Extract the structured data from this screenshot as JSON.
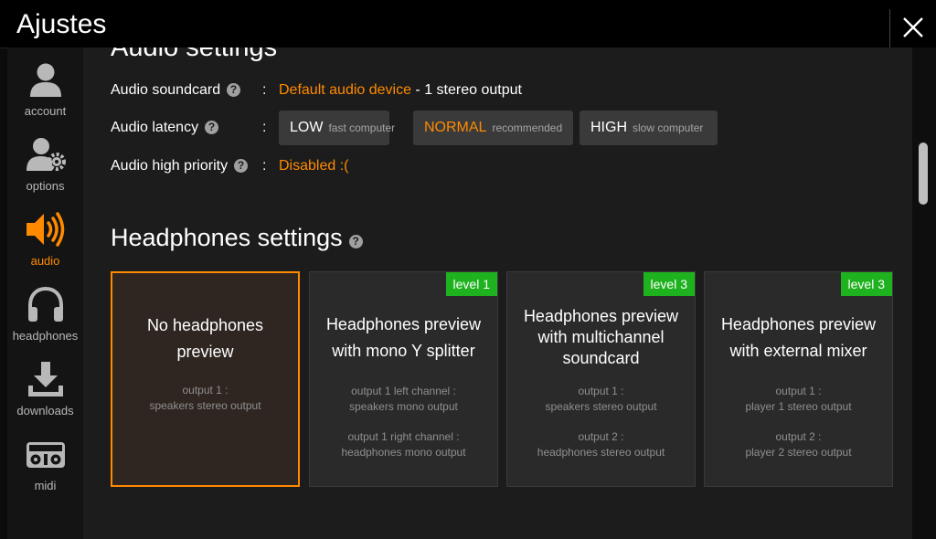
{
  "window": {
    "title": "Ajustes"
  },
  "sidebar": {
    "items": [
      {
        "label": "account",
        "icon": "user-icon"
      },
      {
        "label": "options",
        "icon": "user-gear-icon"
      },
      {
        "label": "audio",
        "icon": "speaker-icon",
        "active": true
      },
      {
        "label": "headphones",
        "icon": "headphones-icon"
      },
      {
        "label": "downloads",
        "icon": "download-icon"
      },
      {
        "label": "midi",
        "icon": "midi-controller-icon"
      }
    ]
  },
  "audio": {
    "heading": "Audio settings",
    "soundcard": {
      "label": "Audio soundcard",
      "value": "Default audio device",
      "suffix": " - 1 stereo output"
    },
    "latency": {
      "label": "Audio latency",
      "options": [
        {
          "main": "LOW",
          "sub": "fast computer"
        },
        {
          "main": "NORMAL",
          "sub": "recommended",
          "selected": true
        },
        {
          "main": "HIGH",
          "sub": "slow computer"
        }
      ]
    },
    "priority": {
      "label": "Audio high priority",
      "value": "Disabled :("
    },
    "colon": ":"
  },
  "headphones": {
    "heading": "Headphones settings",
    "cards": [
      {
        "title": [
          "No headphones",
          "preview"
        ],
        "badge": "",
        "outputs": [
          [
            "output 1 :",
            "speakers stereo output"
          ]
        ],
        "selected": true
      },
      {
        "title": [
          "Headphones preview",
          "with mono Y splitter"
        ],
        "badge": "level 1",
        "outputs": [
          [
            "output 1 left channel :",
            "speakers mono output"
          ],
          [
            "output 1 right channel :",
            "headphones mono output"
          ]
        ]
      },
      {
        "title": [
          "Headphones preview",
          "with multichannel",
          "soundcard"
        ],
        "badge": "level 3",
        "outputs": [
          [
            "output 1 :",
            "speakers stereo output"
          ],
          [
            "output 2 :",
            "headphones stereo output"
          ]
        ]
      },
      {
        "title": [
          "Headphones preview",
          "with external mixer"
        ],
        "badge": "level 3",
        "outputs": [
          [
            "output 1 :",
            "player 1 stereo output"
          ],
          [
            "output 2 :",
            "player 2 stereo output"
          ]
        ]
      }
    ]
  },
  "colors": {
    "accent": "#ff8a00",
    "badge": "#1fb21f"
  }
}
